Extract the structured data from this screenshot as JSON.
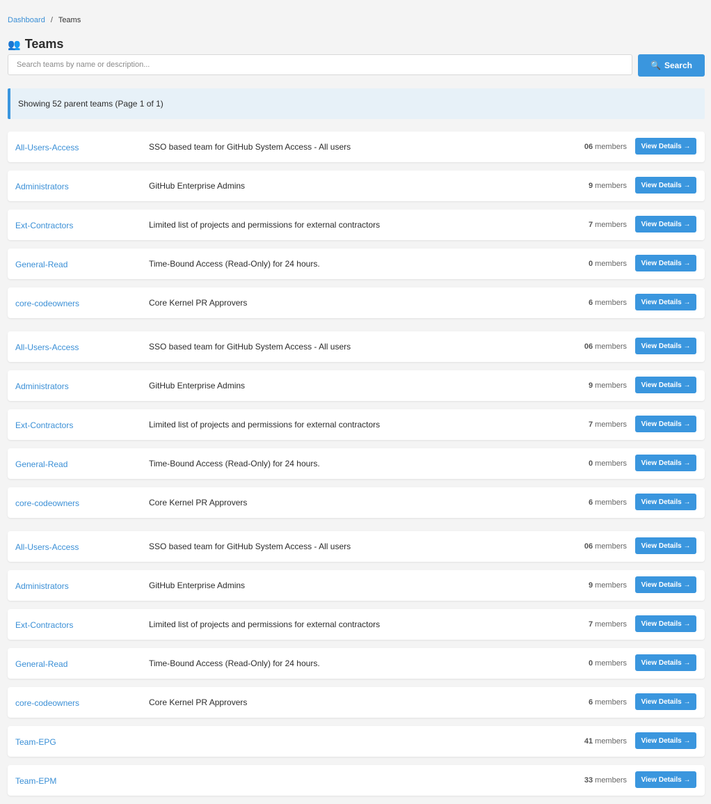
{
  "breadcrumb": {
    "home": "Dashboard",
    "separator": "/",
    "current": "Teams"
  },
  "page": {
    "icon": "👥",
    "title": "Teams"
  },
  "search": {
    "placeholder": "Search teams by name or description...",
    "value": "",
    "button_icon": "🔍",
    "button_label": "Search"
  },
  "info": {
    "text": "Showing 52 parent teams (Page 1 of 1)"
  },
  "members_suffix": "members",
  "view_button_label": "View Details →",
  "teams": [
    {
      "name": "All-Users-Access",
      "description": "SSO based team for GitHub System Access - All users",
      "members": "06"
    },
    {
      "name": "Administrators",
      "description": "GitHub Enterprise Admins",
      "members": "9"
    },
    {
      "name": "Ext-Contractors",
      "description": "Limited list of projects and permissions for external contractors",
      "members": "7"
    },
    {
      "name": "General-Read",
      "description": "Time-Bound Access (Read-Only) for 24 hours.",
      "members": "0"
    },
    {
      "name": "core-codeowners",
      "description": "Core Kernel PR Approvers",
      "members": "6"
    },
    {
      "name": "All-Users-Access",
      "description": "SSO based team for GitHub System Access - All users",
      "members": "06"
    },
    {
      "name": "Administrators",
      "description": "GitHub Enterprise Admins",
      "members": "9"
    },
    {
      "name": "Ext-Contractors",
      "description": "Limited list of projects and permissions for external contractors",
      "members": "7"
    },
    {
      "name": "General-Read",
      "description": "Time-Bound Access (Read-Only) for 24 hours.",
      "members": "0"
    },
    {
      "name": "core-codeowners",
      "description": "Core Kernel PR Approvers",
      "members": "6"
    },
    {
      "name": "All-Users-Access",
      "description": "SSO based team for GitHub System Access - All users",
      "members": "06"
    },
    {
      "name": "Administrators",
      "description": "GitHub Enterprise Admins",
      "members": "9"
    },
    {
      "name": "Ext-Contractors",
      "description": "Limited list of projects and permissions for external contractors",
      "members": "7"
    },
    {
      "name": "General-Read",
      "description": "Time-Bound Access (Read-Only) for 24 hours.",
      "members": "0"
    },
    {
      "name": "core-codeowners",
      "description": "Core Kernel PR Approvers",
      "members": "6"
    },
    {
      "name": "Team-EPG",
      "description": "",
      "members": "41"
    },
    {
      "name": "Team-EPM",
      "description": "",
      "members": "33"
    }
  ],
  "colors": {
    "accent": "#3a96de",
    "link": "#3a8fd6",
    "info_bg": "#e7f1f8"
  }
}
